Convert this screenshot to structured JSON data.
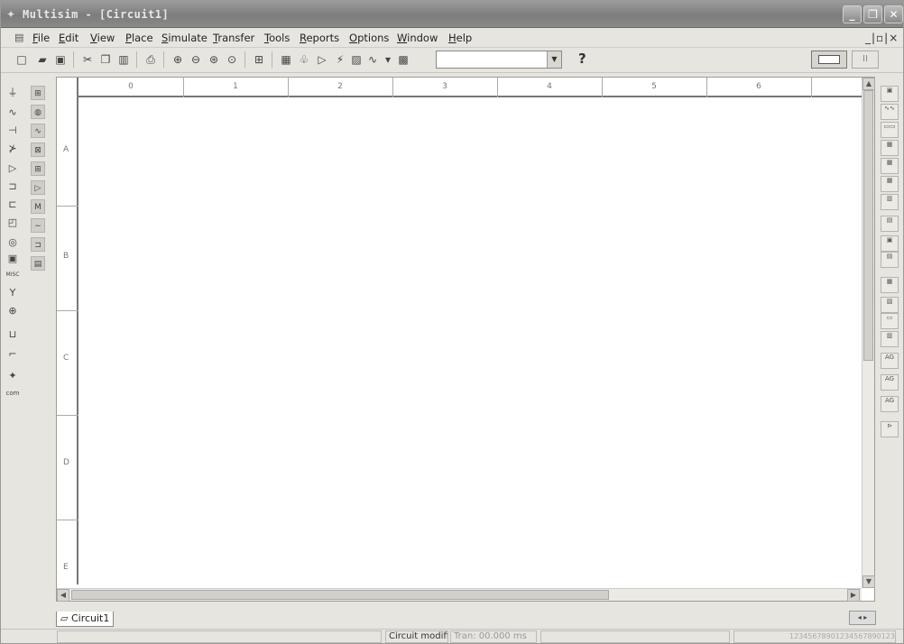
{
  "window": {
    "title": "Multisim - [Circuit1]",
    "minimize_glyph": "_",
    "maximize_glyph": "❐",
    "close_glyph": "✕"
  },
  "menubar": {
    "items": [
      "File",
      "Edit",
      "View",
      "Place",
      "Simulate",
      "Transfer",
      "Tools",
      "Reports",
      "Options",
      "Window",
      "Help"
    ],
    "mdi_controls": "_|▫|×"
  },
  "toolbar": {
    "buttons": [
      "new-icon",
      "open-icon",
      "save-icon",
      "cut-icon",
      "copy-icon",
      "paste-icon",
      "print-icon",
      "zoom-in-icon",
      "zoom-out-icon",
      "zoom-area-icon",
      "zoom-fit-icon",
      "show-grid-icon",
      "spreadsheet-icon",
      "design-toolbox-icon",
      "postprocessor-icon",
      "grapher-icon",
      "analysis-icon",
      "netlist-icon",
      "database-icon"
    ],
    "in_use_list_value": "",
    "help_label": "?",
    "sim_switch_icon": "simulate-switch-icon",
    "pause_label": "II"
  },
  "left_toolbar": {
    "col1": [
      "source-icon",
      "resistor-icon",
      "diode-icon",
      "transistor-icon",
      "analog-icon",
      "ttl-icon",
      "cmos-icon",
      "mixed-icon",
      "indicator-icon",
      "power-icon",
      "misc-icon",
      "rf-icon",
      "electromech-icon",
      "bus-icon",
      "hier-icon",
      "place-node-icon",
      "com-icon"
    ],
    "col1_labels": {
      "misc": "MISC",
      "com": "com"
    },
    "col2": [
      "virtual-analog-icon",
      "virtual-basic-icon",
      "virtual-diode-icon",
      "virtual-transistor-icon",
      "virtual-measure-icon",
      "virtual-misc-icon",
      "virtual-power-icon",
      "virtual-rated-icon",
      "virtual-source-icon",
      "virtual-gate-icon",
      "virtual-ic-icon"
    ]
  },
  "right_toolbar": {
    "instruments": [
      "multimeter-icon",
      "function-generator-icon",
      "wattmeter-icon",
      "oscilloscope-icon",
      "four-channel-scope-icon",
      "bode-plotter-icon",
      "frequency-counter-icon",
      "word-generator-icon",
      "logic-analyzer-icon",
      "logic-converter-icon",
      "iv-analyzer-icon",
      "distortion-analyzer-icon",
      "spectrum-analyzer-icon",
      "network-analyzer-icon",
      "agilent-fgen-icon",
      "agilent-multimeter-icon",
      "agilent-scope-icon",
      "measurement-probe-icon"
    ]
  },
  "ruler": {
    "columns": [
      "0",
      "1",
      "2",
      "3",
      "4",
      "5",
      "6"
    ],
    "rows": [
      "A",
      "B",
      "C",
      "D",
      "E"
    ]
  },
  "tabs": {
    "active": "Circuit1",
    "nav": "◂ ▸"
  },
  "status": {
    "message": "Circuit modified",
    "tran": "Tran: 00.000 ms",
    "coords": "12345678901234567890123"
  }
}
